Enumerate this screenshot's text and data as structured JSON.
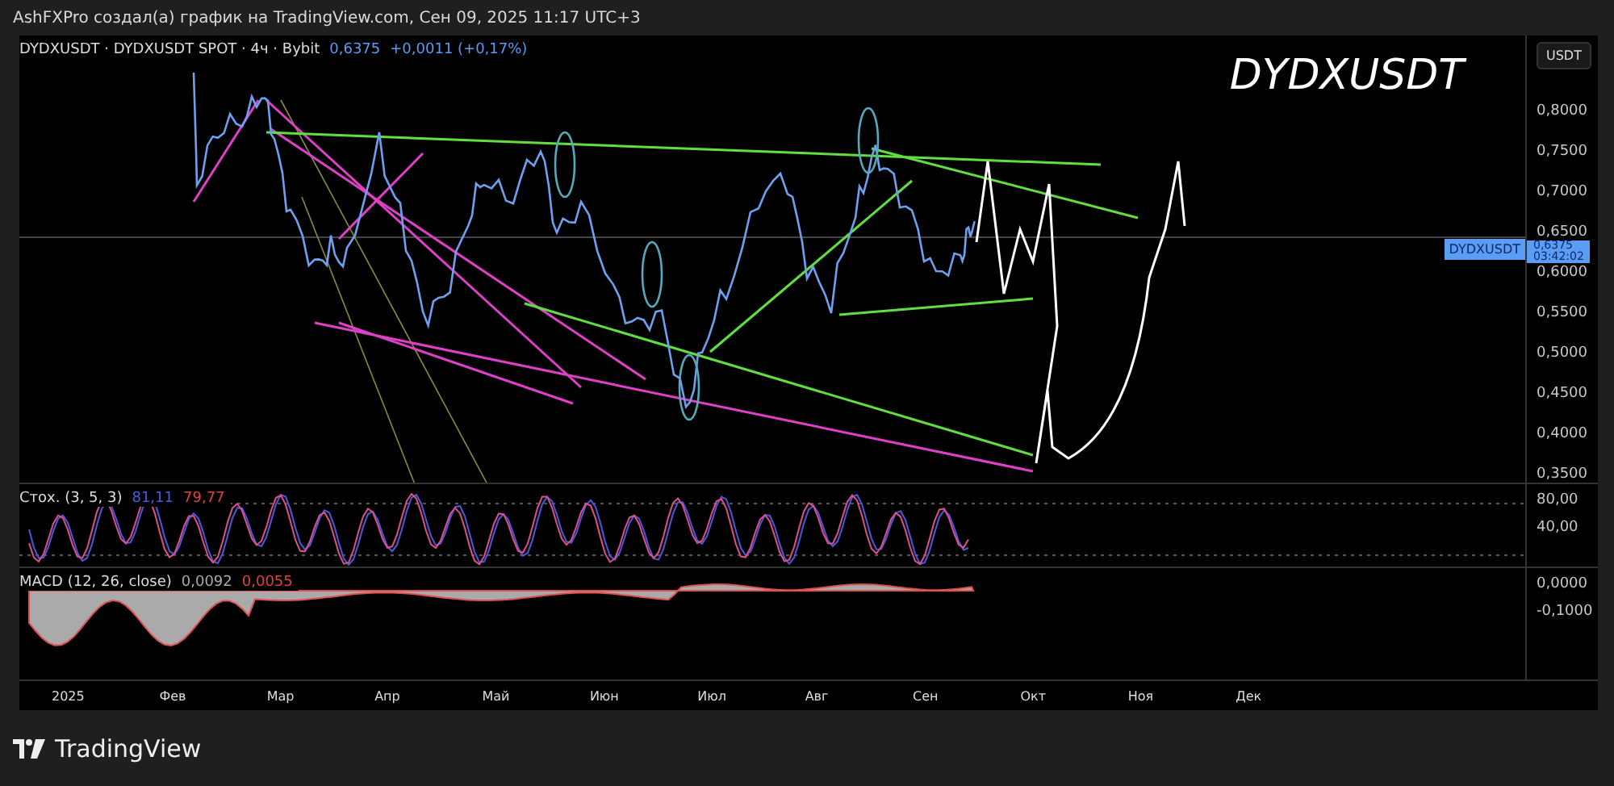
{
  "header": {
    "text": "AshFXPro создал(а) график на TradingView.com, Сен 09, 2025 11:17 UTC+3"
  },
  "legend": {
    "symbol": "DYDXUSDT · DYDXUSDT SPOT · 4ч · Bybit",
    "price": "0,6375",
    "change": "+0,0011 (+0,17%)"
  },
  "chart_title": "DYDXUSDT",
  "price_axis": {
    "unit": "USDT",
    "labels": [
      "0,8000",
      "0,7500",
      "0,7000",
      "0,6500",
      "0,6000",
      "0,5500",
      "0,5000",
      "0,4500",
      "0,4000",
      "0,3500"
    ]
  },
  "price_tag": {
    "symbol": "DYDXUSDT",
    "price": "0,6375",
    "countdown": "03:42:02"
  },
  "stochastic": {
    "label": "Стох. (3, 5, 3)",
    "k": "81,11",
    "d": "79,77",
    "axis": [
      "80,00",
      "40,00"
    ]
  },
  "macd": {
    "label": "MACD (12, 26, close)",
    "macd": "0,0092",
    "signal": "0,0055",
    "axis": [
      "0,0000",
      "-0,1000"
    ]
  },
  "time_axis": [
    "2025",
    "Фев",
    "Мар",
    "Апр",
    "Май",
    "Июн",
    "Июл",
    "Авг",
    "Сен",
    "Окт",
    "Ноя",
    "Дек"
  ],
  "footer": {
    "brand": "TradingView"
  }
}
